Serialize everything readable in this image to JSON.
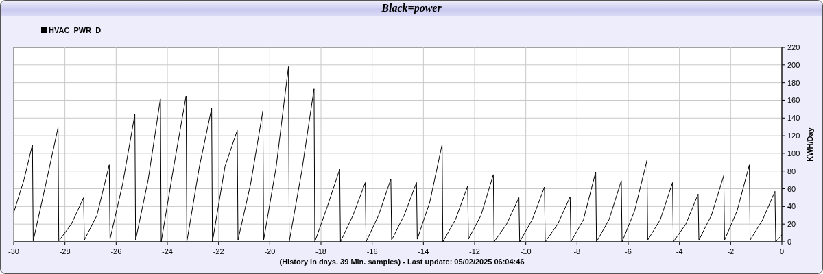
{
  "window": {
    "title": "Black=power"
  },
  "chart": {
    "chart_data": {
      "type": "line",
      "xlabel": "(History in days. 39 Min. samples) - Last update: 05/02/2025 06:04:46",
      "ylabel": "KWH/Day",
      "x": [
        -30,
        -29.6,
        -29.27,
        -29.24,
        -28.75,
        -28.27,
        -28.24,
        -27.75,
        -27.27,
        -27.24,
        -26.75,
        -26.27,
        -26.24,
        -25.75,
        -25.27,
        -25.24,
        -24.75,
        -24.27,
        -24.24,
        -23.75,
        -23.27,
        -23.24,
        -22.75,
        -22.27,
        -22.24,
        -21.75,
        -21.27,
        -21.24,
        -20.75,
        -20.27,
        -20.24,
        -19.75,
        -19.27,
        -19.24,
        -18.75,
        -18.27,
        -18.24,
        -17.75,
        -17.27,
        -17.24,
        -16.75,
        -16.27,
        -16.24,
        -15.75,
        -15.27,
        -15.24,
        -14.75,
        -14.27,
        -14.24,
        -13.75,
        -13.27,
        -13.24,
        -12.75,
        -12.27,
        -12.24,
        -11.75,
        -11.27,
        -11.24,
        -10.75,
        -10.27,
        -10.24,
        -9.75,
        -9.27,
        -9.24,
        -8.75,
        -8.27,
        -8.24,
        -7.75,
        -7.27,
        -7.24,
        -6.75,
        -6.27,
        -6.24,
        -5.75,
        -5.27,
        -5.24,
        -4.75,
        -4.27,
        -4.24,
        -3.75,
        -3.27,
        -3.24,
        -2.75,
        -2.27,
        -2.24,
        -1.75,
        -1.27,
        -1.24,
        -0.75,
        -0.27,
        -0.24,
        0
      ],
      "series": [
        {
          "name": "HVAC_PWR_D",
          "color": "#000000",
          "values": [
            33,
            70,
            110,
            1,
            65,
            129,
            1,
            20,
            50,
            2,
            30,
            87,
            3,
            65,
            144,
            2,
            70,
            162,
            0,
            85,
            165,
            0,
            85,
            151,
            0,
            85,
            126,
            2,
            65,
            148,
            2,
            85,
            198,
            0,
            80,
            173,
            0,
            40,
            82,
            0,
            30,
            67,
            0,
            30,
            71,
            2,
            30,
            67,
            3,
            45,
            110,
            0,
            25,
            63,
            3,
            30,
            76,
            0,
            20,
            50,
            0,
            25,
            62,
            0,
            20,
            51,
            0,
            25,
            79,
            0,
            25,
            69,
            0,
            35,
            92,
            2,
            25,
            67,
            0,
            20,
            54,
            2,
            30,
            75,
            2,
            35,
            87,
            2,
            25,
            57,
            0,
            8
          ]
        }
      ],
      "grid": true,
      "xlim": [
        -30,
        0
      ],
      "ylim": [
        0,
        220
      ],
      "xticks": [
        -30,
        -28,
        -26,
        -24,
        -22,
        -20,
        -18,
        -16,
        -14,
        -12,
        -10,
        -8,
        -6,
        -4,
        -2,
        0
      ],
      "yticks": [
        0,
        20,
        40,
        60,
        80,
        100,
        120,
        140,
        160,
        180,
        200,
        220
      ]
    }
  }
}
